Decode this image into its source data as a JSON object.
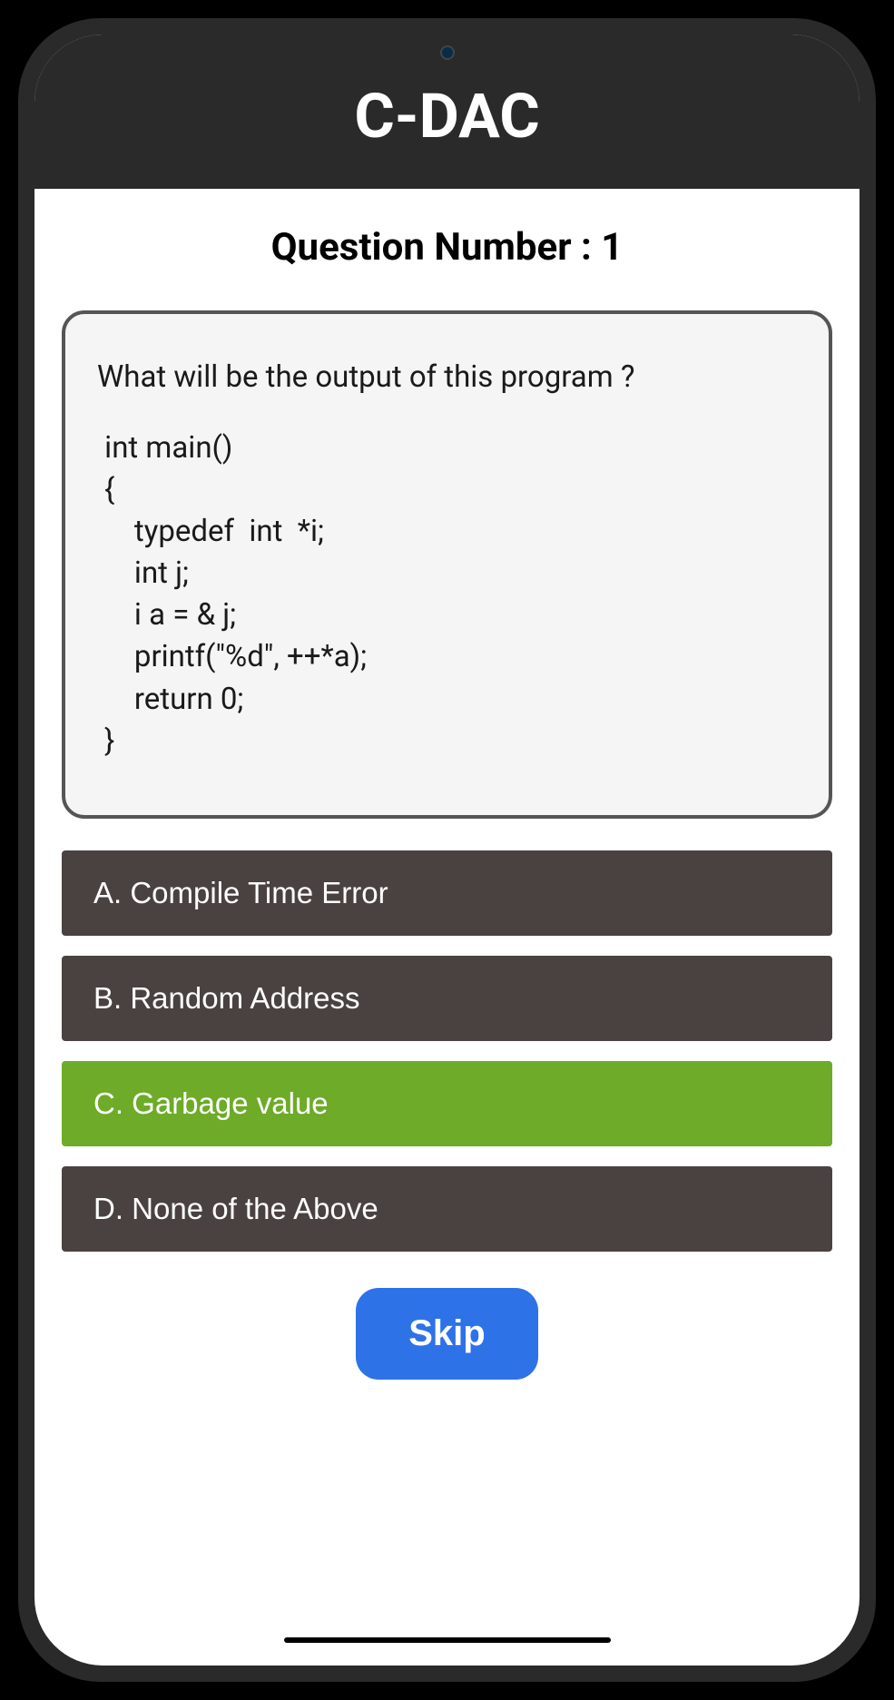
{
  "header": {
    "title": "C-DAC"
  },
  "question": {
    "number_label": "Question Number : 1",
    "prompt": "What will be the output of this program ?",
    "code": " int main()\n {\n     typedef  int  *i;\n     int j;\n     i a = & j;\n     printf(\"%d\", ++*a);\n     return 0;\n }"
  },
  "options": [
    {
      "label": "A. Compile Time Error",
      "selected": false
    },
    {
      "label": "B. Random Address",
      "selected": false
    },
    {
      "label": "C. Garbage value",
      "selected": true
    },
    {
      "label": "D. None of the Above",
      "selected": false
    }
  ],
  "actions": {
    "skip_label": "Skip"
  }
}
